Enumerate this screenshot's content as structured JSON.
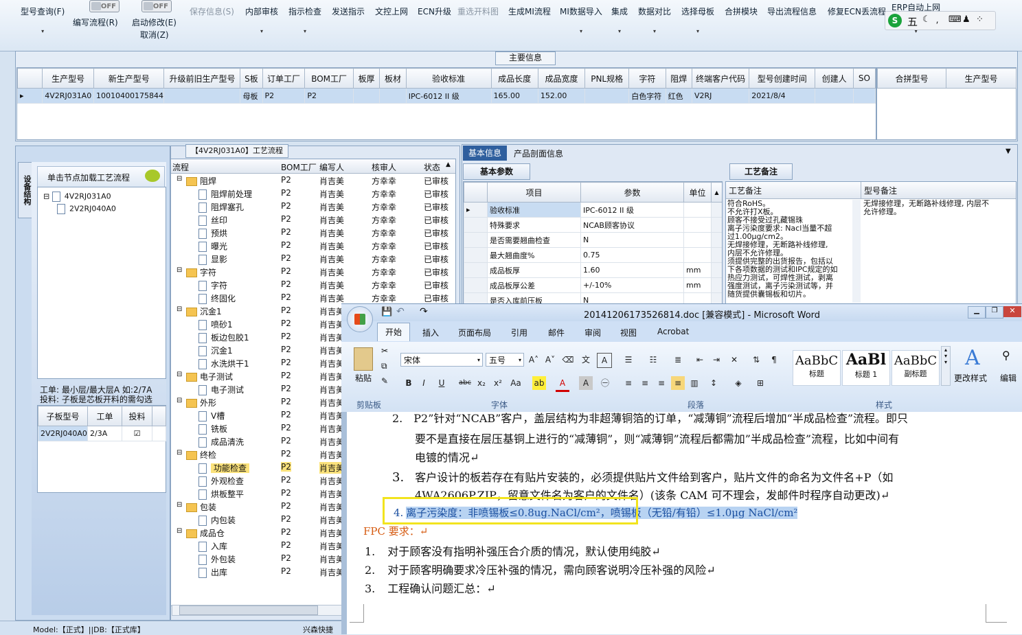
{
  "toolbar": {
    "items": [
      "型号查询(F)",
      "编写流程(R)",
      "启动修改(E)",
      "保存信息(S)",
      "内部审核",
      "指示检查",
      "发送指示",
      "文控上网",
      "ECN升级",
      "重选开料图",
      "生成MI流程",
      "MI数据导入",
      "集成",
      "数据对比",
      "选择母板",
      "合拼模块",
      "导出流程信息",
      "修复ECN丢流程",
      "ERP自动上网"
    ],
    "cancel": "取消(Z)",
    "toggle_text": "OFF"
  },
  "main_info": {
    "title": "主要信息",
    "columns": [
      "生产型号",
      "新生产型号",
      "升级前旧生产型号",
      "S板",
      "订单工厂",
      "BOM工厂",
      "板厚",
      "板材",
      "验收标准",
      "成品长度",
      "成品宽度",
      "PNL规格",
      "字符",
      "阻焊",
      "终端客户代码",
      "型号创建时间",
      "创建人",
      "SO"
    ],
    "row": [
      "4V2RJ031A0",
      "10010400175844",
      "",
      "母板",
      "P2",
      "P2",
      "",
      "",
      "IPC-6012 II 级",
      "165.00",
      "152.00",
      "",
      "白色字符",
      "红色",
      "V2RJ",
      "2021/8/4",
      "",
      ""
    ],
    "right_columns": [
      "合拼型号",
      "生产型号"
    ]
  },
  "left_panel": {
    "vertical_tab": "设备结构",
    "header": "单击节点加载工艺流程",
    "tree": [
      "4V2RJ031A0",
      "2V2RJ040A0"
    ],
    "info1": "工单: 最小层/最大层A 如:2/7A",
    "info2": "投料: 子板是芯板开料的需勾选",
    "sub_columns": [
      "子板型号",
      "工单",
      "投料"
    ],
    "sub_row": [
      "2V2RJ040A0",
      "2/3A"
    ]
  },
  "process": {
    "title": "【4V2RJ031A0】工艺流程",
    "columns": [
      "流程",
      "BOM工厂",
      "编写人",
      "核审人",
      "状态"
    ],
    "rows": [
      {
        "name": "阻焊",
        "folder": true,
        "bom": "P2",
        "writer": "肖吉美",
        "reviewer": "方幸幸",
        "status": "已审核"
      },
      {
        "name": "阻焊前处理",
        "folder": false,
        "bom": "P2",
        "writer": "肖吉美",
        "reviewer": "方幸幸",
        "status": "已审核"
      },
      {
        "name": "阻焊塞孔",
        "folder": false,
        "bom": "P2",
        "writer": "肖吉美",
        "reviewer": "方幸幸",
        "status": "已审核"
      },
      {
        "name": "丝印",
        "folder": false,
        "bom": "P2",
        "writer": "肖吉美",
        "reviewer": "方幸幸",
        "status": "已审核"
      },
      {
        "name": "预烘",
        "folder": false,
        "bom": "P2",
        "writer": "肖吉美",
        "reviewer": "方幸幸",
        "status": "已审核"
      },
      {
        "name": "曝光",
        "folder": false,
        "bom": "P2",
        "writer": "肖吉美",
        "reviewer": "方幸幸",
        "status": "已审核"
      },
      {
        "name": "显影",
        "folder": false,
        "bom": "P2",
        "writer": "肖吉美",
        "reviewer": "方幸幸",
        "status": "已审核"
      },
      {
        "name": "字符",
        "folder": true,
        "bom": "P2",
        "writer": "肖吉美",
        "reviewer": "方幸幸",
        "status": "已审核"
      },
      {
        "name": "字符",
        "folder": false,
        "bom": "P2",
        "writer": "肖吉美",
        "reviewer": "方幸幸",
        "status": "已审核"
      },
      {
        "name": "终固化",
        "folder": false,
        "bom": "P2",
        "writer": "肖吉美",
        "reviewer": "方幸幸",
        "status": "已审核"
      },
      {
        "name": "沉金1",
        "folder": true,
        "bom": "P2",
        "writer": "肖吉美",
        "reviewer": "",
        "status": ""
      },
      {
        "name": "喷砂1",
        "folder": false,
        "bom": "P2",
        "writer": "肖吉美",
        "reviewer": "",
        "status": ""
      },
      {
        "name": "板边包胶1",
        "folder": false,
        "bom": "P2",
        "writer": "肖吉美",
        "reviewer": "",
        "status": ""
      },
      {
        "name": "沉金1",
        "folder": false,
        "bom": "P2",
        "writer": "肖吉美",
        "reviewer": "",
        "status": ""
      },
      {
        "name": "水洗烘干1",
        "folder": false,
        "bom": "P2",
        "writer": "肖吉美",
        "reviewer": "",
        "status": ""
      },
      {
        "name": "电子测试",
        "folder": true,
        "bom": "P2",
        "writer": "肖吉美",
        "reviewer": "",
        "status": ""
      },
      {
        "name": "电子测试",
        "folder": false,
        "bom": "P2",
        "writer": "肖吉美",
        "reviewer": "",
        "status": ""
      },
      {
        "name": "外形",
        "folder": true,
        "bom": "P2",
        "writer": "肖吉美",
        "reviewer": "",
        "status": ""
      },
      {
        "name": "V槽",
        "folder": false,
        "bom": "P2",
        "writer": "肖吉美",
        "reviewer": "",
        "status": ""
      },
      {
        "name": "铣板",
        "folder": false,
        "bom": "P2",
        "writer": "肖吉美",
        "reviewer": "",
        "status": ""
      },
      {
        "name": "成品清洗",
        "folder": false,
        "bom": "P2",
        "writer": "肖吉美",
        "reviewer": "",
        "status": ""
      },
      {
        "name": "终检",
        "folder": true,
        "bom": "P2",
        "writer": "肖吉美",
        "reviewer": "",
        "status": ""
      },
      {
        "name": "功能检查",
        "folder": false,
        "bom": "P2",
        "writer": "肖吉美",
        "reviewer": "",
        "status": "",
        "selected": true
      },
      {
        "name": "外观检查",
        "folder": false,
        "bom": "P2",
        "writer": "肖吉美",
        "reviewer": "",
        "status": ""
      },
      {
        "name": "烘板整平",
        "folder": false,
        "bom": "P2",
        "writer": "肖吉美",
        "reviewer": "",
        "status": ""
      },
      {
        "name": "包装",
        "folder": true,
        "bom": "P2",
        "writer": "肖吉美",
        "reviewer": "",
        "status": ""
      },
      {
        "name": "内包装",
        "folder": false,
        "bom": "P2",
        "writer": "肖吉美",
        "reviewer": "",
        "status": ""
      },
      {
        "name": "成品仓",
        "folder": true,
        "bom": "P2",
        "writer": "肖吉美",
        "reviewer": "",
        "status": ""
      },
      {
        "name": "入库",
        "folder": false,
        "bom": "P2",
        "writer": "肖吉美",
        "reviewer": "",
        "status": ""
      },
      {
        "name": "外包装",
        "folder": false,
        "bom": "P2",
        "writer": "肖吉美",
        "reviewer": "",
        "status": ""
      },
      {
        "name": "出库",
        "folder": false,
        "bom": "P2",
        "writer": "肖吉美",
        "reviewer": "",
        "status": ""
      }
    ]
  },
  "right_panel": {
    "tabs": [
      "基本信息",
      "产品剖面信息"
    ],
    "basic_title": "基本参数",
    "param_columns": [
      "项目",
      "参数",
      "单位"
    ],
    "params": [
      [
        "验收标准",
        "IPC-6012 II 级",
        ""
      ],
      [
        "特殊要求",
        "NCAB顾客协议",
        ""
      ],
      [
        "是否需要翘曲检查",
        "N",
        ""
      ],
      [
        "最大翘曲度%",
        "0.75",
        ""
      ],
      [
        "成品板厚",
        "1.60",
        "mm"
      ],
      [
        "成品板厚公差",
        "+/-10%",
        "mm"
      ],
      [
        "是否入库前压板",
        "N",
        ""
      ]
    ],
    "craft_title": "工艺备注",
    "craft_columns": [
      "工艺备注",
      "型号备注"
    ],
    "craft_text": [
      "符合RoHS。",
      "不允许打X板。",
      "顾客不接受过孔藏锡珠",
      "离子污染度要求: Nacl当量不超",
      "过1.00μg/cm2。",
      "无焊接修理，无断路补线修理,",
      "内层不允许修理。",
      "须提供完整的出货报告，包括以",
      "下各项数据的测试和IPC规定的如",
      "热应力测试，可焊性测试，剥离",
      "强度测试，离子污染测试等，并",
      "随货提供囊锡板和切片。"
    ],
    "model_text": [
      "无焊接修理，无断路补线修理, 内层不",
      "允许修理。"
    ]
  },
  "word": {
    "title": "20141206173526814.doc [兼容模式] - Microsoft Word",
    "tabs": [
      "开始",
      "插入",
      "页面布局",
      "引用",
      "邮件",
      "审阅",
      "视图",
      "Acrobat"
    ],
    "font": "宋体",
    "size": "五号",
    "paste": "粘贴",
    "groups": [
      "剪贴板",
      "字体",
      "段落",
      "样式"
    ],
    "styles": [
      {
        "sample": "AaBbC",
        "name": "标题"
      },
      {
        "sample": "AaBl",
        "name": "标题 1"
      },
      {
        "sample": "AaBbC",
        "name": "副标题"
      }
    ],
    "change_style": "更改样式",
    "edit": "编辑",
    "lines": [
      {
        "num": "2.",
        "text": "P2”针对“NCAB”客户，盖层结构为非超薄铜箔的订单，“减薄铜”流程后增加“半成品检查”流程。即只"
      },
      {
        "num": "",
        "text": "要不是直接在层压基铜上进行的“减薄铜”，则“减薄铜”流程后都需加”半成品检查”流程，比如中间有"
      },
      {
        "num": "",
        "text": "电镀的情况↵"
      },
      {
        "num": "3.",
        "text": "客户设计的板若存在有贴片安装的，必须提供贴片文件给到客户，贴片文件的命名为文件名+P（如"
      },
      {
        "num": "",
        "text": "4WA2606P.ZIP，留意文件名为客户的文件名）(该条 CAM 可不理会，发邮件时程序自动更改)↵"
      }
    ],
    "highlight_num": "4.",
    "highlight_text": "离子污染度：非喷锡板≤0.8ug.NaCl/cm²，喷锡板（无铅/有铅）≤1.0μg NaCl/cm²",
    "fpc_title": "FPC 要求：↵",
    "fpc_items": [
      {
        "num": "1.",
        "text": "对于顾客没有指明补强压合介质的情况，默认使用纯胶↵"
      },
      {
        "num": "2.",
        "text": "对于顾客明确要求冷压补强的情况，需向顾客说明冷压补强的风险↵"
      },
      {
        "num": "3.",
        "text": "工程确认问题汇总：↵"
      }
    ]
  },
  "status": {
    "model": "Model:【正式】||DB:【正式库】",
    "company": "兴森快捷"
  },
  "ime": {
    "mode": "五"
  },
  "colors": {
    "accent": "#2b6cb0",
    "highlight_box": "#f2e41d",
    "fpc": "#d65b11",
    "selection": "#b8d3f2"
  }
}
